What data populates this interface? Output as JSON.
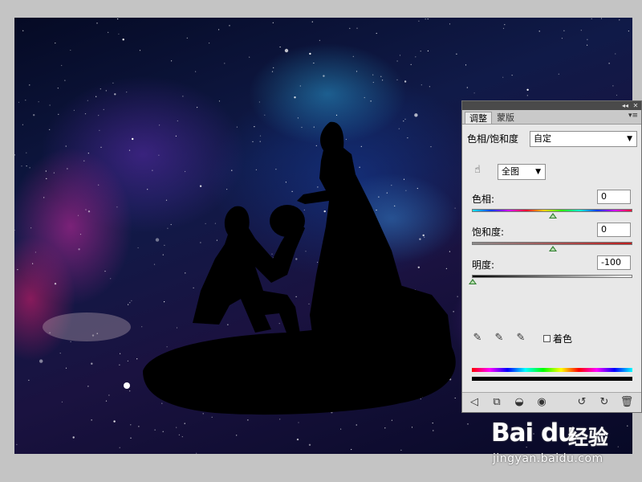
{
  "panel": {
    "tabs": [
      {
        "label": "调整",
        "active": true
      },
      {
        "label": "蒙版",
        "active": false
      }
    ],
    "adjustment_name": "色相/饱和度",
    "preset": {
      "value": "自定"
    },
    "channel": {
      "value": "全图"
    },
    "hue": {
      "label": "色相:",
      "value": "0"
    },
    "saturation": {
      "label": "饱和度:",
      "value": "0"
    },
    "lightness": {
      "label": "明度:",
      "value": "-100"
    },
    "colorize": {
      "label": "着色",
      "checked": false
    }
  },
  "watermark": {
    "brand": "Bai du",
    "product": "经验",
    "url": "jingyan.baidu.com"
  },
  "colors": {
    "panel_bg": "#e8e8e8",
    "titlebar": "#4a4a4a",
    "thumb": "#2f7d2f"
  }
}
